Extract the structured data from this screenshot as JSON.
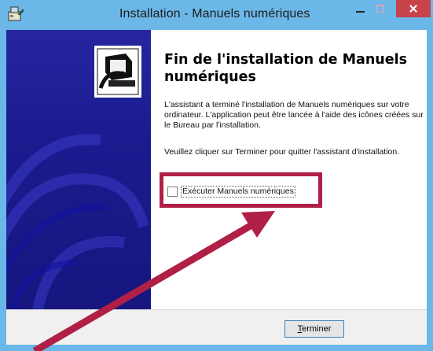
{
  "window": {
    "title": "Installation - Manuels numériques",
    "app_icon": "installer-icon",
    "controls": {
      "minimize": "minimize-icon",
      "maximize": "maximize-icon",
      "close": "close-icon"
    }
  },
  "wizard": {
    "heading": "Fin de l'installation de Manuels numériques",
    "paragraph1": "L'assistant a terminé l'installation de Manuels numériques sur votre ordinateur. L'application peut être lancée à l'aide des icônes créées sur le Bureau par l'installation.",
    "paragraph2": "Veuillez cliquer sur Terminer pour quitter l'assistant d'installation.",
    "run_checkbox": {
      "label": "Exécuter Manuels numériques",
      "checked": false
    },
    "finish_button": {
      "accel": "T",
      "rest": "erminer"
    },
    "side_image": "computer-install-icon"
  },
  "annotation": {
    "color": "#b01f45",
    "highlight": "highlight-box",
    "arrow": "arrow-icon"
  },
  "colors": {
    "titlebar": "#6bb7e8",
    "close": "#c7434a",
    "panel": "#1b1b8f"
  }
}
